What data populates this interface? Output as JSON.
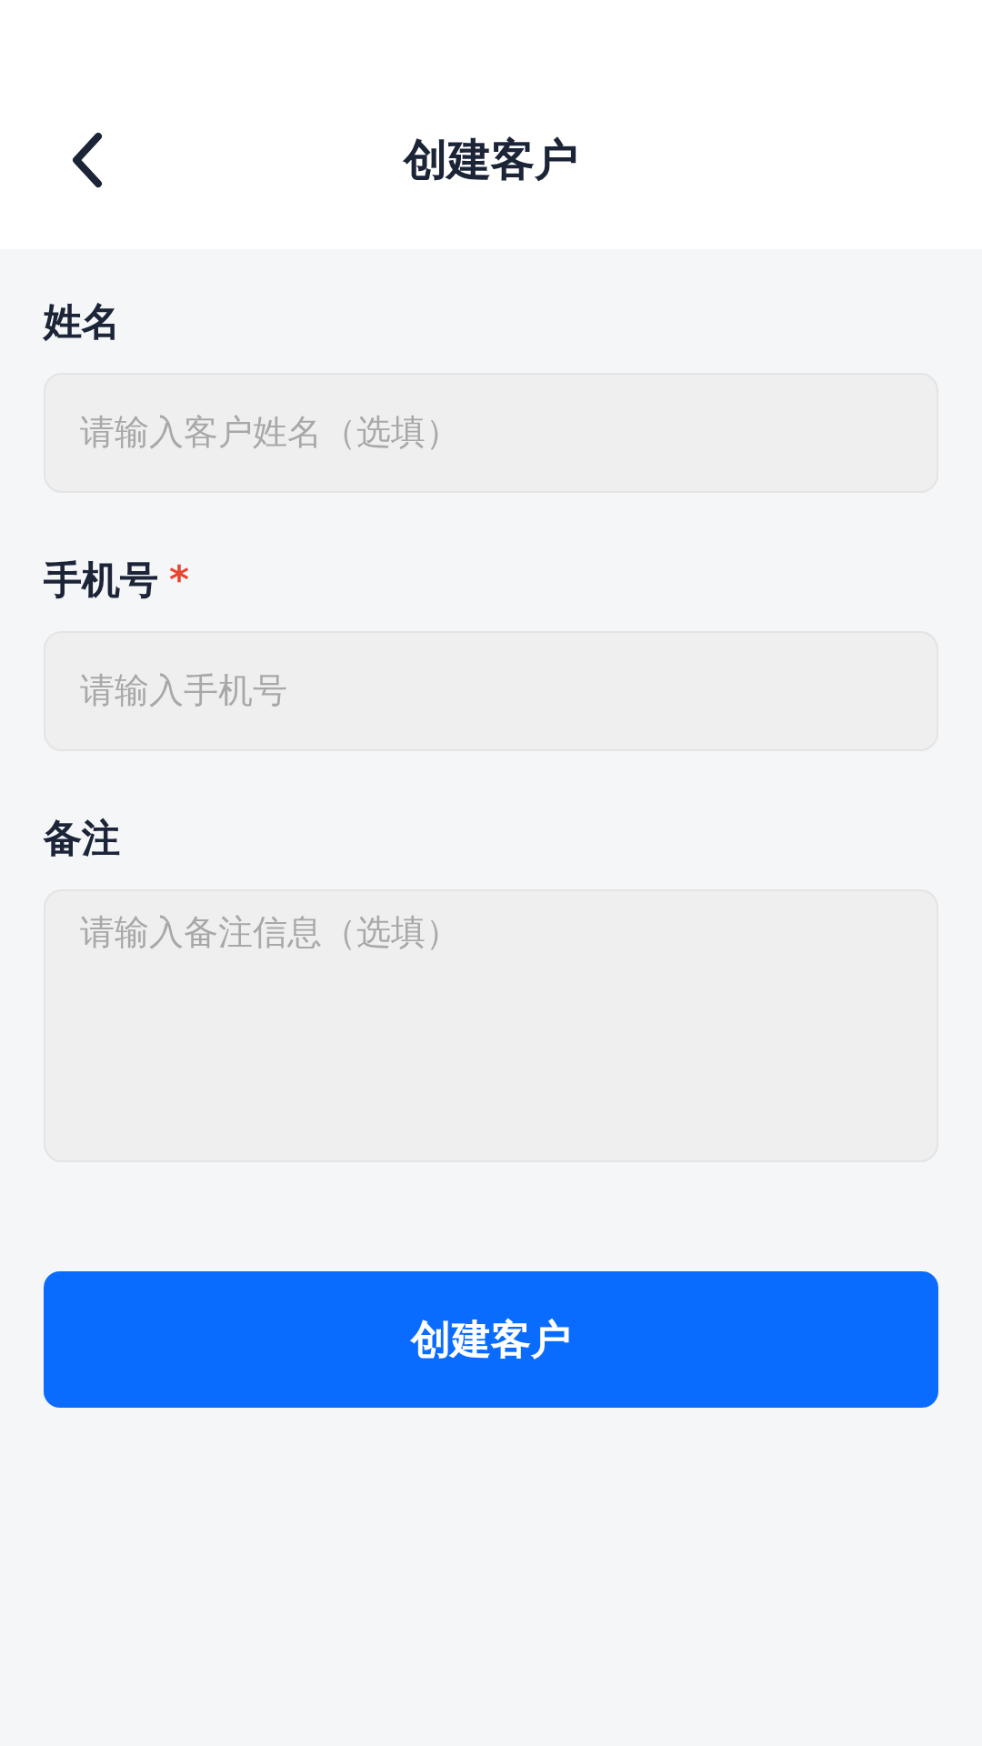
{
  "header": {
    "title": "创建客户"
  },
  "fields": [
    {
      "label": "姓名",
      "kind": "input",
      "placeholder": "请输入客户姓名（选填）"
    },
    {
      "label": "手机号",
      "required_mark": "*",
      "kind": "input",
      "placeholder": "请输入手机号"
    },
    {
      "label": "备注",
      "kind": "textarea",
      "placeholder": "请输入备注信息（选填）"
    }
  ],
  "submit_button": "创建客户"
}
